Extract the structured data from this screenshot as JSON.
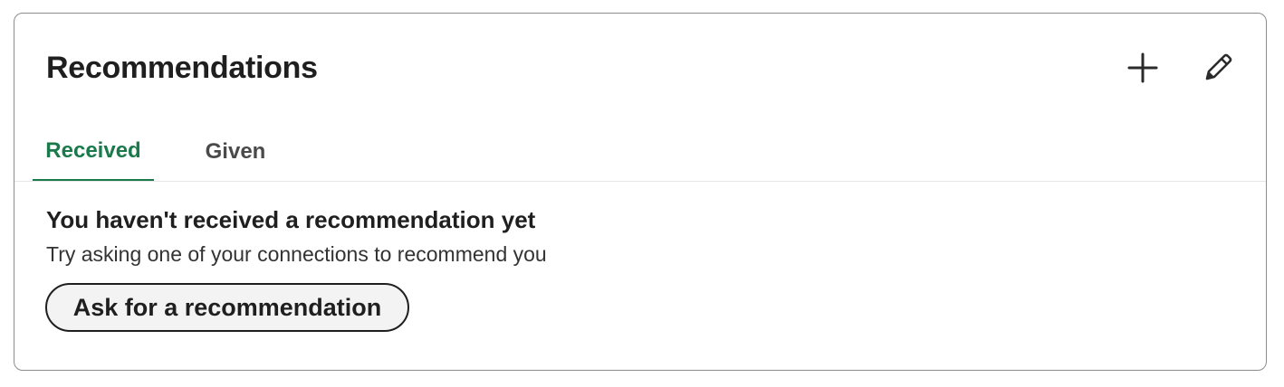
{
  "section": {
    "title": "Recommendations",
    "actions": {
      "add_icon": "plus-icon",
      "edit_icon": "pencil-icon"
    }
  },
  "tabs": [
    {
      "label": "Received",
      "active": true
    },
    {
      "label": "Given",
      "active": false
    }
  ],
  "empty_state": {
    "heading": "You haven't received a recommendation yet",
    "subtext": "Try asking one of your connections to recommend you",
    "button_label": "Ask for a recommendation"
  },
  "colors": {
    "accent": "#1b7a4c",
    "text": "#1f1f1f",
    "border": "#8c8c8c"
  }
}
